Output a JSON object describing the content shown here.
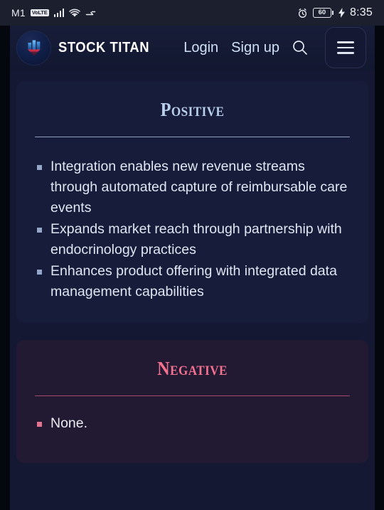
{
  "status_bar": {
    "carrier": "M1",
    "volte_label": "VoLTE",
    "signal_icon": "signal-bars-icon",
    "wifi_icon": "wifi-icon",
    "data_sync_icon": "data-transfer-icon",
    "alarm_icon": "alarm-clock-icon",
    "battery_level": "60",
    "charging_icon": "charging-bolt-icon",
    "time": "8:35"
  },
  "navbar": {
    "logo_icon": "stock-titan-logo-icon",
    "brand_name": "STOCK TITAN",
    "login_label": "Login",
    "signup_label": "Sign up",
    "search_icon": "search-icon",
    "menu_icon": "hamburger-menu-icon"
  },
  "cards": {
    "positive": {
      "title": "Positive",
      "accent_color": "#b9d0ec",
      "background": "#171c3a",
      "bullets": [
        "Integration enables new revenue streams through automated capture of reimbursable care events",
        "Expands market reach through partnership with endocrinology practices",
        "Enhances product offering with integrated data management capabilities"
      ]
    },
    "negative": {
      "title": "Negative",
      "accent_color": "#f4718f",
      "background": "#221a33",
      "bullets": [
        "None."
      ]
    }
  }
}
